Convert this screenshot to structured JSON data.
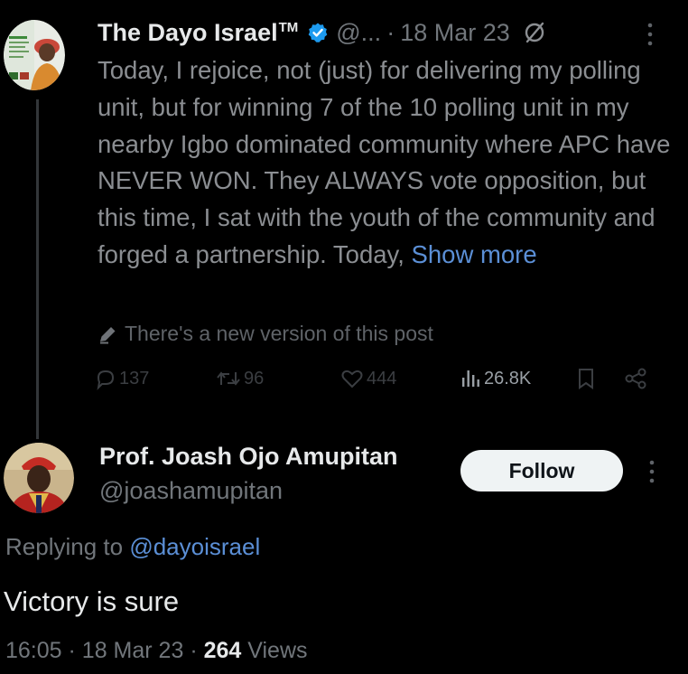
{
  "tweet": {
    "author_name": "The Dayo Israel",
    "trademark": "TM",
    "handle": "@...",
    "separator": "·",
    "date": "18 Mar 23",
    "text": "Today, I rejoice, not (just) for delivering my polling unit, but for winning 7 of the 10 polling unit in my nearby Igbo dominated community where APC have NEVER WON. They ALWAYS vote opposition, but this time, I sat with the youth of the community and forged a partnership. Today, ",
    "show_more_label": "Show more",
    "new_version_notice": "There's a new version of this post",
    "actions": {
      "replies": "137",
      "reposts": "96",
      "likes": "444",
      "views": "26.8K"
    },
    "icons": [
      "verified-icon",
      "grok-icon",
      "more-icon",
      "pencil-icon",
      "reply-icon",
      "retweet-icon",
      "heart-icon",
      "views-chart-icon",
      "bookmark-icon",
      "share-icon"
    ]
  },
  "reply": {
    "author_name": "Prof. Joash Ojo Amupitan",
    "handle": "@joashamupitan",
    "follow_label": "Follow",
    "replying_to_prefix": "Replying to ",
    "replying_to_handle": "@dayoisrael",
    "text": "Victory is sure",
    "time": "16:05",
    "separator": "·",
    "date": "18 Mar 23",
    "views_count": "264",
    "views_label": "Views"
  },
  "colors": {
    "background": "#000000",
    "primary_text": "#e7e9ea",
    "secondary_text": "#71767b",
    "link_blue": "#5b8fd6",
    "verified_blue": "#1d9bf0",
    "follow_bg": "#eff3f4"
  }
}
